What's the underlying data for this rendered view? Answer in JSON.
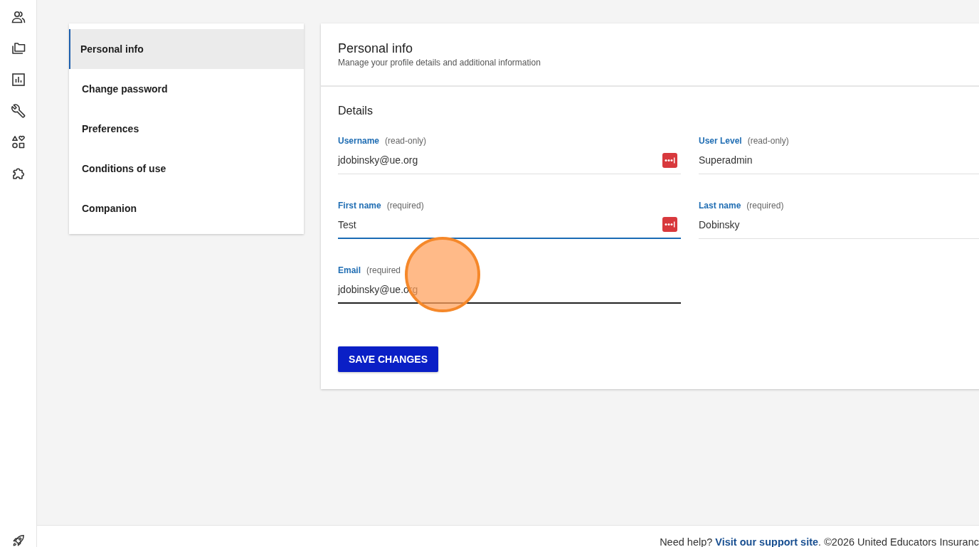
{
  "side_nav": {
    "items": [
      {
        "label": "Personal info",
        "selected": true
      },
      {
        "label": "Change password",
        "selected": false
      },
      {
        "label": "Preferences",
        "selected": false
      },
      {
        "label": "Conditions of use",
        "selected": false
      },
      {
        "label": "Companion",
        "selected": false
      }
    ]
  },
  "panel": {
    "title": "Personal info",
    "subtitle": "Manage your profile details and additional information",
    "section_title": "Details",
    "fields": [
      {
        "label": "Username",
        "hint": "(read-only)",
        "value": "jdobinsky@ue.org",
        "focused": false,
        "hovered": false,
        "autofill_icon": true
      },
      {
        "label": "User Level",
        "hint": "(read-only)",
        "value": "Superadmin",
        "focused": false,
        "hovered": false,
        "autofill_icon": false
      },
      {
        "label": "First name",
        "hint": "(required)",
        "value": "Test",
        "focused": true,
        "hovered": false,
        "autofill_icon": true
      },
      {
        "label": "Last name",
        "hint": "(required)",
        "value": "Dobinsky",
        "focused": false,
        "hovered": false,
        "autofill_icon": false
      },
      {
        "label": "Email",
        "hint": "(required",
        "value": "jdobinsky@ue.org",
        "focused": false,
        "hovered": true,
        "autofill_icon": false
      }
    ],
    "save_button": "SAVE CHANGES"
  },
  "footer": {
    "prefix": "Need help? ",
    "link": "Visit our support site",
    "suffix": ". ©2026 United Educators Insuranc"
  }
}
